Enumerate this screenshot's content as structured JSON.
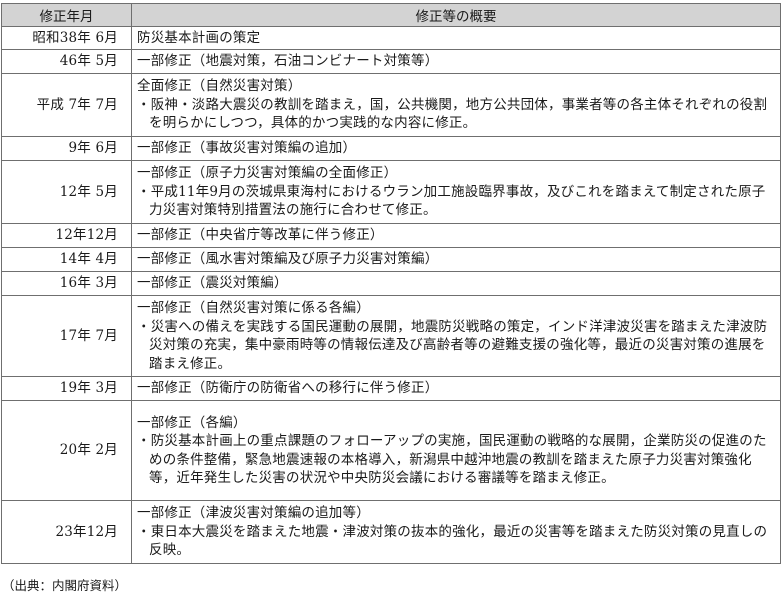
{
  "table": {
    "headers": [
      "修正年月",
      "修正等の概要"
    ],
    "rows": [
      {
        "date": "昭和38年 6月",
        "title": "防災基本計画の策定",
        "detail": ""
      },
      {
        "date": "46年 5月",
        "title": "一部修正（地震対策，石油コンビナート対策等）",
        "detail": ""
      },
      {
        "date": "平成 7年 7月",
        "title": "全面修正（自然災害対策）",
        "detail": "・阪神・淡路大震災の教訓を踏まえ，国，公共機関，地方公共団体，事業者等の各主体それぞれの役割を明らかにしつつ，具体的かつ実践的な内容に修正。"
      },
      {
        "date": "9年 6月",
        "title": "一部修正（事故災害対策編の追加）",
        "detail": ""
      },
      {
        "date": "12年 5月",
        "title": "一部修正（原子力災害対策編の全面修正）",
        "detail": "・平成11年9月の茨城県東海村におけるウラン加工施設臨界事故，及びこれを踏まえて制定された原子力災害対策特別措置法の施行に合わせて修正。"
      },
      {
        "date": "12年12月",
        "title": "一部修正（中央省庁等改革に伴う修正）",
        "detail": ""
      },
      {
        "date": "14年 4月",
        "title": "一部修正（風水害対策編及び原子力災害対策編）",
        "detail": ""
      },
      {
        "date": "16年 3月",
        "title": "一部修正（震災対策編）",
        "detail": ""
      },
      {
        "date": "17年 7月",
        "title": "一部修正（自然災害対策に係る各編）",
        "detail": "・災害への備えを実践する国民運動の展開，地震防災戦略の策定，インド洋津波災害を踏まえた津波防災対策の充実，集中豪雨時等の情報伝達及び高齢者等の避難支援の強化等，最近の災害対策の進展を踏まえ修正。"
      },
      {
        "date": "19年 3月",
        "title": "一部修正（防衛庁の防衛省への移行に伴う修正）",
        "detail": ""
      },
      {
        "date": "20年 2月",
        "title": "一部修正（各編）",
        "detail": "・防災基本計画上の重点課題のフォローアップの実施，国民運動の戦略的な展開，企業防災の促進のための条件整備，緊急地震速報の本格導入，新潟県中越沖地震の教訓を踏まえた原子力災害対策強化等，近年発生した災害の状況や中央防災会議における審議等を踏まえ修正。"
      },
      {
        "date": "23年12月",
        "title": "一部修正（津波災害対策編の追加等）",
        "detail": "・東日本大震災を踏まえた地震・津波対策の抜本的強化，最近の災害等を踏まえた防災対策の見直しの反映。"
      }
    ]
  },
  "source": "（出典：内閣府資料）"
}
